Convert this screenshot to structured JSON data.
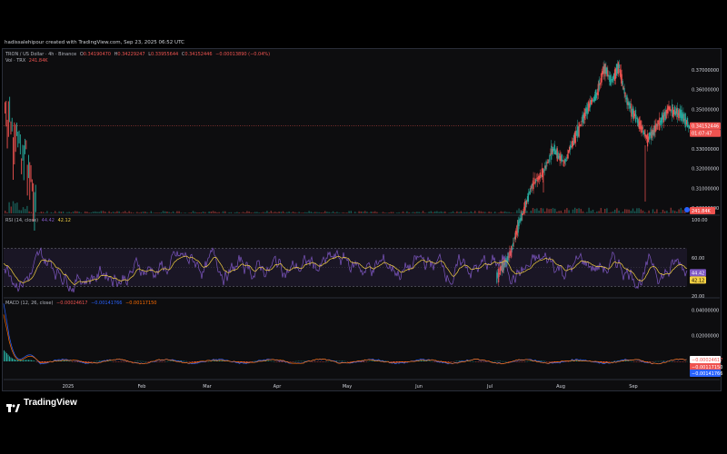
{
  "header": {
    "credit": "hadissalehipour created with TradingView.com, Sep 23, 2025 06:52 UTC"
  },
  "price_legend": {
    "symbol": "TRON / US Dollar · 4h · Binance",
    "o_label": "O",
    "o_value": "0.34190470",
    "h_label": "H",
    "h_value": "0.34229247",
    "l_label": "L",
    "l_value": "0.33955644",
    "c_label": "C",
    "c_value": "0.34152446",
    "change": "−0.00013890 (−0.04%)",
    "vol_label": "Vol · TRX",
    "vol_value": "241.84K"
  },
  "rsi_legend": {
    "label": "RSI (14, close)",
    "v1": "44.42",
    "v2": "42.12"
  },
  "macd_legend": {
    "label": "MACD (12, 26, close)",
    "v1": "−0.00024617",
    "v2": "−0.00141766",
    "v3": "−0.00117150"
  },
  "badges": {
    "price": "0.34152446",
    "countdown": "01:07:47",
    "volume": "241.84K",
    "rsi1": "44.42",
    "rsi2": "42.12",
    "macd1": "−0.00024617",
    "macd2": "−0.00117150",
    "macd3": "−0.00141766"
  },
  "brand": {
    "name": "TradingView"
  },
  "colors": {
    "up": "#26a69a",
    "down": "#ef5350",
    "rsi": "#7e57c2",
    "rsi_ma": "#f5d142",
    "macd": "#2962ff",
    "signal": "#ff6d00"
  },
  "chart_data": [
    {
      "type": "candlestick",
      "title": "TRON / US Dollar · 4h · Binance",
      "x_ticks": [
        "2025",
        "Feb",
        "Mar",
        "Apr",
        "May",
        "Jun",
        "Jul",
        "Aug",
        "Sep"
      ],
      "y_ticks": [
        "0.37000000",
        "0.36000000",
        "0.35000000",
        "0.33000000",
        "0.32000000",
        "0.31000000",
        "0.30000000"
      ],
      "ylim": [
        0.2968,
        0.3745
      ],
      "visible_price_path": [
        [
          0.2,
          0.41
        ],
        [
          0.5,
          0.44
        ],
        [
          1.0,
          0.32
        ],
        [
          1.4,
          0.27
        ],
        [
          2.0,
          0.245
        ],
        [
          7.1,
          0.265
        ],
        [
          7.3,
          0.278
        ],
        [
          7.45,
          0.296
        ],
        [
          7.6,
          0.312
        ],
        [
          7.75,
          0.318
        ],
        [
          7.9,
          0.33
        ],
        [
          8.05,
          0.323
        ],
        [
          8.2,
          0.336
        ],
        [
          8.35,
          0.349
        ],
        [
          8.5,
          0.358
        ],
        [
          8.6,
          0.371
        ],
        [
          8.7,
          0.364
        ],
        [
          8.8,
          0.372
        ],
        [
          8.9,
          0.355
        ],
        [
          9.05,
          0.345
        ],
        [
          9.2,
          0.335
        ],
        [
          9.35,
          0.342
        ],
        [
          9.5,
          0.35
        ],
        [
          9.65,
          0.348
        ],
        [
          9.8,
          0.341
        ]
      ],
      "last_price": 0.34152446,
      "note_volume_last": "241.84K"
    },
    {
      "type": "line",
      "name": "RSI (14, close)",
      "y_ticks": [
        "100.00",
        "60.00",
        "20.00"
      ],
      "ylim": [
        20,
        100
      ],
      "bands": [
        30,
        70
      ],
      "series": [
        {
          "name": "RSI",
          "last": 44.42
        },
        {
          "name": "RSI-MA",
          "last": 42.12
        }
      ]
    },
    {
      "type": "line",
      "name": "MACD (12, 26, close)",
      "y_ticks": [
        "0.04000000",
        "0.02000000"
      ],
      "ylim": [
        -0.012,
        0.048
      ],
      "series": [
        {
          "name": "Histogram",
          "last": -0.00024617
        },
        {
          "name": "MACD",
          "last": -0.00141766
        },
        {
          "name": "Signal",
          "last": -0.0011715
        }
      ]
    }
  ]
}
